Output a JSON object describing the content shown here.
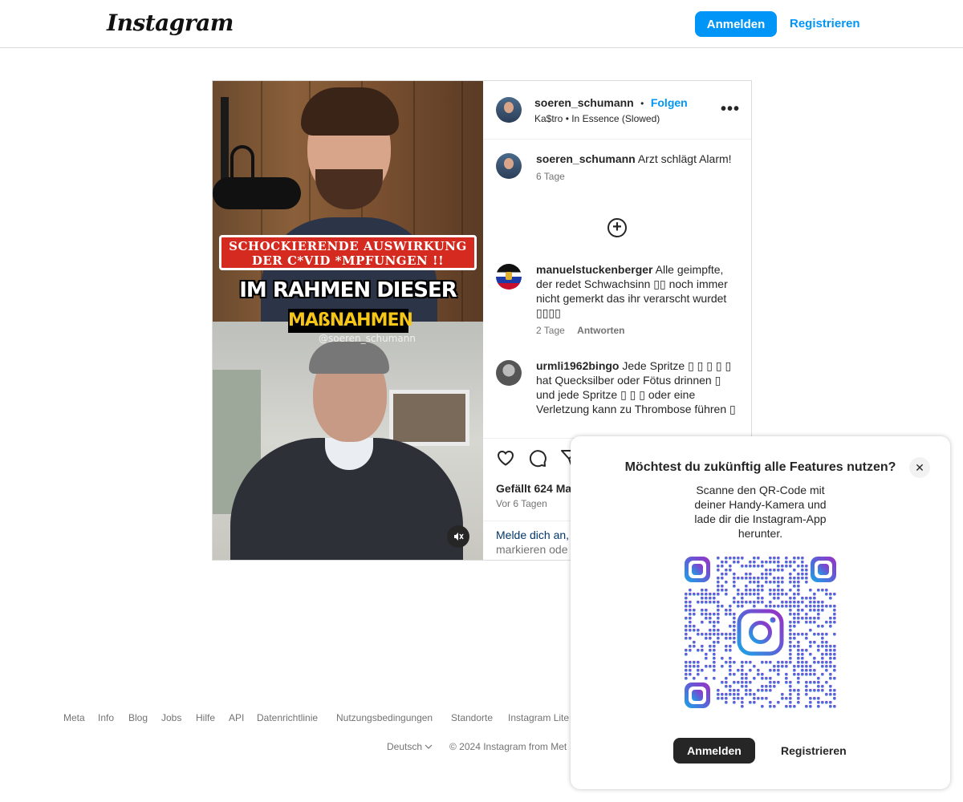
{
  "header": {
    "logo": "Instagram",
    "login_label": "Anmelden",
    "register_label": "Registrieren"
  },
  "post": {
    "author": "soeren_schumann",
    "follow_label": "Folgen",
    "audio": "Ka$tro • In Essence (Slowed)",
    "media": {
      "caption_red_line1": "SCHOCKIERENDE AUSWIRKUNG",
      "caption_red_line2": "DER C*VID *MPFUNGEN !!",
      "caption_white": "IM RAHMEN DIESER",
      "caption_yellow": "MAßNAHMEN",
      "watermark": "@soeren_schumann"
    },
    "caption": {
      "user": "soeren_schumann",
      "text": "Arzt schlägt Alarm!",
      "time": "6 Tage"
    },
    "comments": [
      {
        "user": "manuelstuckenberger",
        "text": "Alle geimpfte, der redet Schwachsinn ▯▯ noch immer nicht gemerkt das ihr verarscht wurdet ▯▯▯▯",
        "time": "2 Tage",
        "reply_label": "Antworten"
      },
      {
        "user": "urmli1962bingo",
        "text": "Jede Spritze ▯ ▯ ▯ ▯ ▯ hat Quecksilber oder Fötus drinnen ▯ und jede Spritze ▯ ▯ ▯ oder eine Verletzung kann zu Thrombose führen ▯",
        "time": "",
        "reply_label": ""
      }
    ],
    "likes": "Gefällt 624 Ma",
    "ago": "Vor 6 Tagen",
    "login_prompt_link": "Melde dich an,",
    "login_prompt_rest": "markieren ode"
  },
  "footer": {
    "links": [
      "Meta",
      "Info",
      "Blog",
      "Jobs",
      "Hilfe",
      "API",
      "Datenrichtlinie",
      "Nutzungsbedingungen",
      "Standorte",
      "Instagram Lite"
    ],
    "language": "Deutsch",
    "copyright": "© 2024 Instagram from Met"
  },
  "modal": {
    "title": "Möchtest du zukünftig alle Features nutzen?",
    "text": "Scanne den QR-Code mit deiner Handy-Kamera und lade dir die Instagram-App herunter.",
    "login_label": "Anmelden",
    "register_label": "Registrieren"
  },
  "icons": {
    "heart": "heart-icon",
    "comment": "comment-icon",
    "share": "share-icon",
    "more": "more-options-icon",
    "close": "close-icon",
    "mute": "mute-icon",
    "add": "add-comment-icon",
    "chevron": "chevron-down-icon"
  },
  "colors": {
    "accent": "#0095f6",
    "text": "#262626",
    "secondary": "#737373",
    "border": "#dbdbdb"
  }
}
